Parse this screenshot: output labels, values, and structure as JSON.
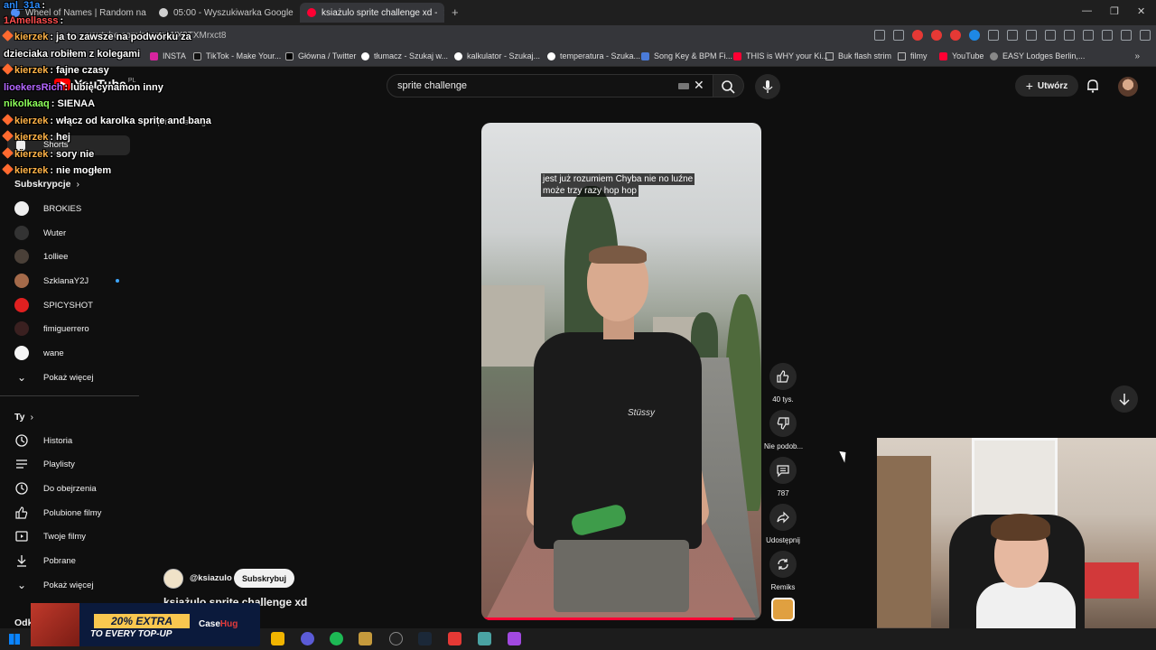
{
  "browser": {
    "tabs": [
      {
        "title": "Wheel of Names | Random name pic",
        "color": "#4f8ef7"
      },
      {
        "title": "05:00 - Wyszukiwarka Google",
        "color": "#cfcfcf"
      },
      {
        "title": "ksiażulo sprite challenge xd -",
        "color": "#ff0033"
      }
    ],
    "url": "youtube.com/shorts/WX9TXMrxct8",
    "bookmarks": [
      {
        "label": "INSTA",
        "type": "site"
      },
      {
        "label": "TikTok - Make Your...",
        "type": "site"
      },
      {
        "label": "Główna / Twitter",
        "type": "site"
      },
      {
        "label": "tłumacz - Szukaj w...",
        "type": "site"
      },
      {
        "label": "kalkulator - Szukaj...",
        "type": "site"
      },
      {
        "label": "temperatura - Szuka...",
        "type": "site"
      },
      {
        "label": "Song Key & BPM Fi...",
        "type": "site"
      },
      {
        "label": "THIS is WHY your Ki...",
        "type": "site"
      },
      {
        "label": "Buk flash strim",
        "type": "folder"
      },
      {
        "label": "filmy",
        "type": "folder"
      },
      {
        "label": "YouTube",
        "type": "site"
      },
      {
        "label": "EASY Lodges Berlin,...",
        "type": "site"
      }
    ]
  },
  "youtube": {
    "logo": "YouTube",
    "logo_region": "PL",
    "search_query": "sprite challenge",
    "create_label": "Utwórz",
    "chip_under_search": "sprite challenge"
  },
  "sidebar": {
    "shorts_label": "Shorts",
    "subscriptions_header": "Subskrypcje",
    "subscriptions": [
      {
        "name": "BROKIES",
        "color": "#eeeeee",
        "dot": false
      },
      {
        "name": "Wuter",
        "color": "#333333",
        "dot": false
      },
      {
        "name": "1olliee",
        "color": "#4a4038",
        "dot": false
      },
      {
        "name": "SzklanaY2J",
        "color": "#a46a4a",
        "dot": true
      },
      {
        "name": "SPICYSHOT",
        "color": "#e02020",
        "dot": false
      },
      {
        "name": "fimiguerrero",
        "color": "#3a2020",
        "dot": false
      },
      {
        "name": "wane",
        "color": "#f5f5f5",
        "dot": false
      }
    ],
    "show_more_1": "Pokaż więcej",
    "you_header": "Ty",
    "you_items": [
      {
        "label": "Historia",
        "icon": "history-icon"
      },
      {
        "label": "Playlisty",
        "icon": "playlist-icon"
      },
      {
        "label": "Do obejrzenia",
        "icon": "clock-icon"
      },
      {
        "label": "Polubione filmy",
        "icon": "thumb-up-icon"
      },
      {
        "label": "Twoje filmy",
        "icon": "video-icon"
      },
      {
        "label": "Pobrane",
        "icon": "download-icon"
      }
    ],
    "show_more_2": "Pokaż więcej",
    "explore_header": "Odkr"
  },
  "video": {
    "caption_line1": "jest już rozumiem Chyba nie no luźne",
    "caption_line2": "może trzy razy hop hop",
    "progress": 0.9,
    "channel": "@ksiazulo",
    "subscribe_label": "Subskrybuj",
    "title": "ksiażulo sprite challenge xd"
  },
  "actions": [
    {
      "label": "40 tys.",
      "icon": "thumb-up-icon"
    },
    {
      "label": "Nie podob...",
      "icon": "thumb-down-icon"
    },
    {
      "label": "787",
      "icon": "comment-icon"
    },
    {
      "label": "Udostępnij",
      "icon": "share-icon"
    },
    {
      "label": "Remiks",
      "icon": "remix-icon"
    }
  ],
  "chat": [
    {
      "user": "anl_31a",
      "text": "",
      "color": "#2b8cff"
    },
    {
      "user": "1Amellasss",
      "text": "",
      "color": "#ff4d4d"
    },
    {
      "user": "kierzek",
      "text": "ja to zawsze na podwórku za",
      "color": "#ffb347"
    },
    {
      "user": "",
      "text": "dzieciaka robiłem z kolegami",
      "color": "#ffffff"
    },
    {
      "user": "kierzek",
      "text": "fajne czasy",
      "color": "#ffb347"
    },
    {
      "user": "lioekersRich",
      "text": "lubię cynamon inny",
      "color": "#b366ff"
    },
    {
      "user": "nikolkaaq",
      "text": "SIENAA",
      "color": "#8dff5a"
    },
    {
      "user": "kierzek",
      "text": "włącz od karolka sprite and bana",
      "color": "#ffb347"
    },
    {
      "user": "kierzek",
      "text": "hej",
      "color": "#ffb347"
    },
    {
      "user": "kierzek",
      "text": "sory nie",
      "color": "#ffb347"
    },
    {
      "user": "kierzek",
      "text": "nie mogłem",
      "color": "#ffb347"
    }
  ],
  "ad": {
    "headline": "20% EXTRA",
    "subline": "TO EVERY TOP-UP",
    "brand_a": "Case",
    "brand_b": "Hug"
  }
}
